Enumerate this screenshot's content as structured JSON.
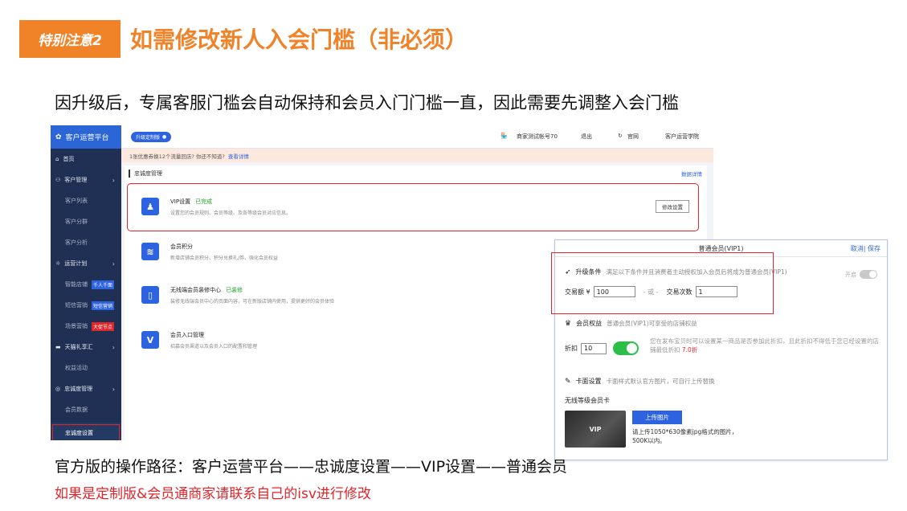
{
  "header": {
    "tag": "特别注意2",
    "title": "如需修改新人入会门槛（非必须）",
    "intro": "因升级后，专属客服门槛会自动保持和会员入门门槛一直，因此需要先调整入会门槛"
  },
  "screenshot": {
    "sidebar": {
      "brand": "客户运营平台",
      "items": [
        {
          "label": "首页",
          "icon": "home-icon"
        },
        {
          "label": "客户管理",
          "icon": "users-icon"
        },
        {
          "label": "客户列表"
        },
        {
          "label": "客户分群"
        },
        {
          "label": "客户分析"
        },
        {
          "label": "运营计划",
          "icon": "bulb-icon"
        },
        {
          "label": "智能店铺",
          "badge": "千人千面",
          "badge_color": "#2d63e0"
        },
        {
          "label": "短信营销",
          "badge": "短信营销",
          "badge_color": "#2d63e0"
        },
        {
          "label": "场景营销",
          "badge": "大促节点",
          "badge_color": "#e0252b"
        },
        {
          "label": "天猫礼享汇",
          "icon": "gift-icon"
        },
        {
          "label": "权益活动"
        },
        {
          "label": "忠诚度管理",
          "icon": "target-icon"
        },
        {
          "label": "会员数据"
        },
        {
          "label": "忠诚度设置"
        }
      ]
    },
    "topbar": {
      "upgrade": "升级定制版",
      "account": "商家测试帐号70",
      "logout": "退出",
      "official": "官网",
      "academy": "客户运营学院"
    },
    "notice": {
      "text": "1张优惠券换12个流量回店? 你还不知道?",
      "link": "查看详情"
    },
    "panel": {
      "heading": "忠诚度管理",
      "link": "数据详情",
      "cards": [
        {
          "title": "VIP设置",
          "status": "已完成",
          "desc": "设置您的会员规则、会员等级、及各等级会员对应信息。",
          "button": "修改设置",
          "icon": "vip-user-icon"
        },
        {
          "title": "会员积分",
          "status": "",
          "desc": "新增店铺会员积分、积分兑换礼/券、强化会员权益",
          "icon": "coins-icon"
        },
        {
          "title": "无线端会员装修中心",
          "status": "已装修",
          "desc": "装修无线端会员中心的页面内容，可在新版店铺内使用，提供更好的会员体验",
          "icon": "phone-icon"
        },
        {
          "title": "会员入口管理",
          "status": "",
          "desc": "招募会员渠道以及会员入口的配置和管理",
          "icon": "v-entry-icon"
        }
      ]
    },
    "popup": {
      "title": "普通会员(VIP1)",
      "actions": "取消| 保存",
      "upgrade": {
        "label": "升级条件",
        "hint": "满足以下条件并且消费者主动授权加入会员后将成为普通会员(VIP1)",
        "switch_label": "开启",
        "amount_label": "交易额 ¥",
        "amount_value": "100",
        "or_label": "- 或 -",
        "count_label": "交易次数",
        "count_value": "1"
      },
      "benefits": {
        "label": "会员权益",
        "hint": "普通会员(VIP1)可享受的店铺权益",
        "discount_label": "折扣",
        "discount_value": "10",
        "note_a": "您在发布宝贝时可以设置某一商品是否参加此折扣，且此折扣不得低于您已经设置的店铺最低折扣",
        "note_min": "7.0折"
      },
      "card": {
        "label": "卡面设置",
        "hint": "卡面样式默认官方图片，可自行上传替换",
        "subtitle": "无线等级会员卡",
        "card_text": "VIP",
        "upload": "上传图片",
        "upload_note": "请上传1050*630像素jpg格式的图片，500K以内。"
      }
    }
  },
  "footer": {
    "path": "官方版的操作路径：客户运营平台——忠诚度设置——VIP设置——普通会员",
    "contact": "如果是定制版&会员通商家请联系自己的isv进行修改"
  }
}
